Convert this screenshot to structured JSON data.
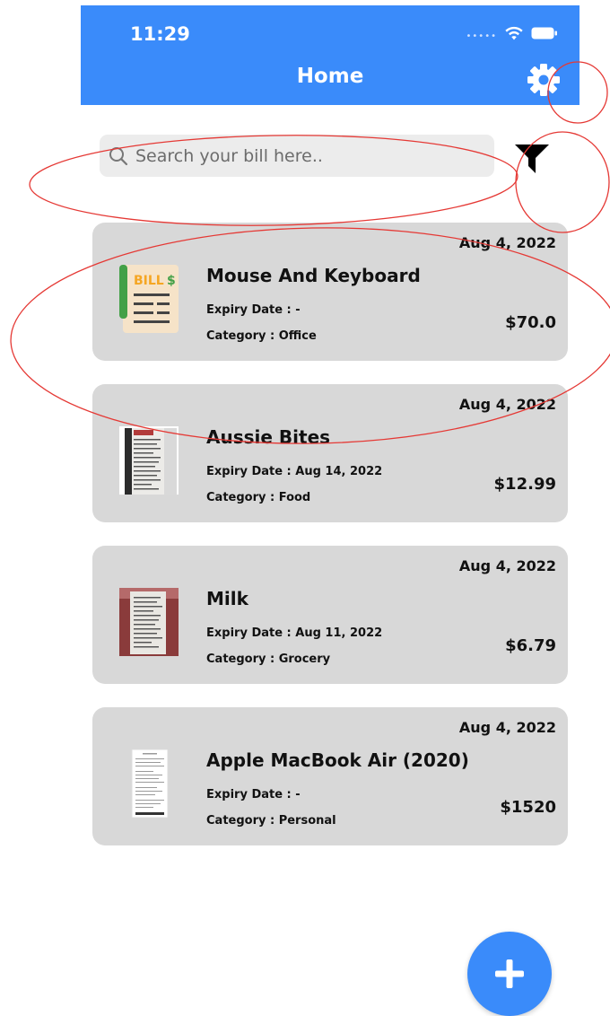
{
  "status_bar": {
    "time": "11:29"
  },
  "header": {
    "title": "Home",
    "settings_icon": "gear-icon"
  },
  "search": {
    "placeholder": "Search your bill here..",
    "value": "",
    "filter_icon": "filter-icon"
  },
  "colors": {
    "accent": "#3a8bfa",
    "card_bg": "#d8d8d8",
    "annotation": "#e53935"
  },
  "bills": [
    {
      "date": "Aug 4, 2022",
      "title": "Mouse And Keyboard",
      "expiry": "Expiry Date : -",
      "category": "Category : Office",
      "amount": "$70.0",
      "thumbnail": "bill-icon"
    },
    {
      "date": "Aug 4, 2022",
      "title": "Aussie Bites",
      "expiry": "Expiry Date : Aug 14, 2022",
      "category": "Category : Food",
      "amount": "$12.99",
      "thumbnail": "receipt-photo"
    },
    {
      "date": "Aug 4, 2022",
      "title": "Milk",
      "expiry": "Expiry Date : Aug 11, 2022",
      "category": "Category : Grocery",
      "amount": "$6.79",
      "thumbnail": "receipt-photo"
    },
    {
      "date": "Aug 4, 2022",
      "title": "Apple MacBook Air (2020)",
      "expiry": "Expiry Date : -",
      "category": "Category : Personal",
      "amount": "$1520",
      "thumbnail": "receipt-photo"
    }
  ],
  "fab": {
    "icon": "plus-icon"
  }
}
